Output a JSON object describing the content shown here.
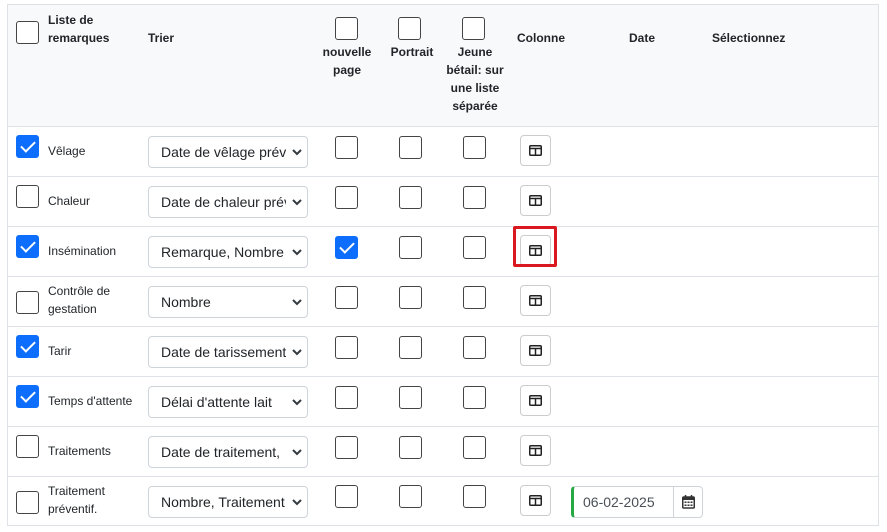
{
  "header": {
    "list_label": "Liste de remarques",
    "sort_label": "Trier",
    "new_page_label": "nouvelle page",
    "portrait_label": "Portrait",
    "young_stock_label": "Jeune bétail: sur une liste séparée",
    "column_label": "Colonne",
    "date_label": "Date",
    "select_label": "Sélectionnez"
  },
  "rows": [
    {
      "label": "Vêlage",
      "sort": "Date de vêlage prévue",
      "checked": true,
      "new_page": false
    },
    {
      "label": "Chaleur",
      "sort": "Date de chaleur prévue",
      "checked": false,
      "new_page": false
    },
    {
      "label": "Insémination",
      "sort": "Remarque, Nombre",
      "checked": true,
      "new_page": true
    },
    {
      "label": "Contrôle de gestation",
      "sort": "Nombre",
      "checked": false,
      "new_page": false
    },
    {
      "label": "Tarir",
      "sort": "Date de tarissement",
      "checked": true,
      "new_page": false
    },
    {
      "label": "Temps d'attente",
      "sort": "Délai d'attente lait",
      "checked": true,
      "new_page": false
    },
    {
      "label": "Traitements",
      "sort": "Date de traitement,",
      "checked": false,
      "new_page": false
    },
    {
      "label": "Traitement préventif.",
      "sort": "Nombre, Traitement",
      "checked": false,
      "new_page": false,
      "date": "06-02-2025"
    }
  ],
  "icons": {
    "column": "column-layout-icon",
    "calendar": "calendar-icon",
    "dropdown": "chevron-down-icon"
  },
  "colors": {
    "checkbox_checked": "#0d6efd",
    "highlight": "#d9191f",
    "date_accent": "#28a745"
  }
}
